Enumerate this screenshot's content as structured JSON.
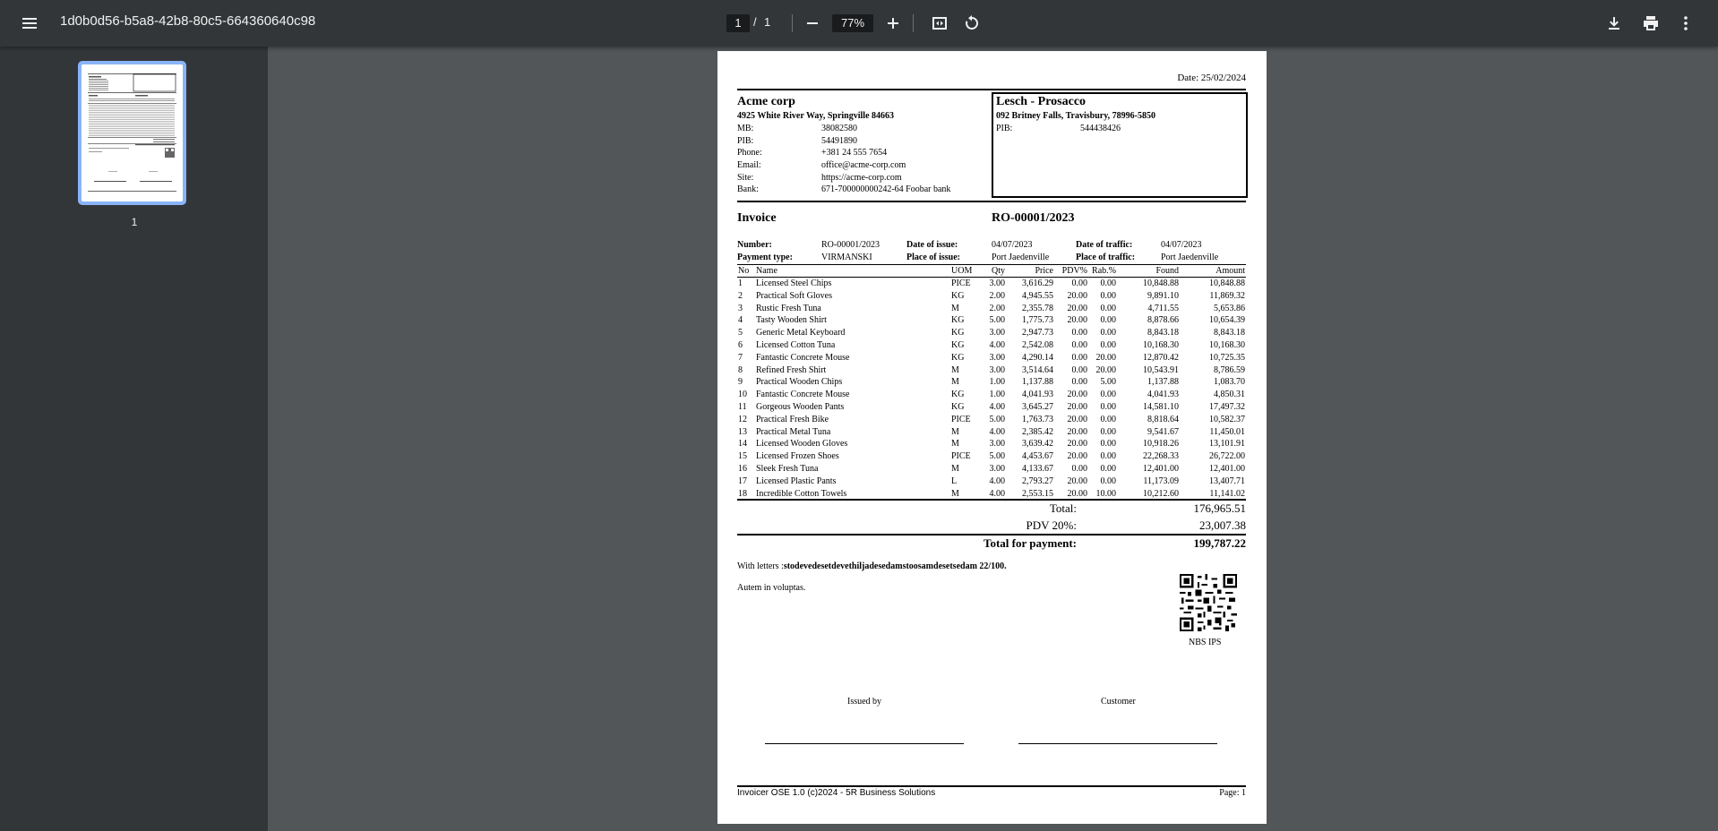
{
  "toolbar": {
    "doc_title": "1d0b0d56-b5a8-42b8-80c5-664360640c98",
    "current_page": "1",
    "page_separator": "/",
    "total_pages": "1",
    "zoom": "77%"
  },
  "sidebar": {
    "thumb_page_number": "1"
  },
  "invoice": {
    "date_line": "Date: 25/02/2024",
    "seller": {
      "name": "Acme corp",
      "address": "4925 White River Way, Springville 84663",
      "fields": [
        {
          "label": "MB:",
          "value": "38082580"
        },
        {
          "label": "PIB:",
          "value": "54491890"
        },
        {
          "label": "Phone:",
          "value": "+381 24 555 7654"
        },
        {
          "label": "Email:",
          "value": "office@acme-corp.com"
        },
        {
          "label": "Site:",
          "value": "https://acme-corp.com"
        },
        {
          "label": "Bank:",
          "value": "671-700000000242-64 Foobar bank"
        }
      ]
    },
    "buyer": {
      "name": "Lesch - Prosacco",
      "address": "092 Britney Falls, Travisbury, 78996-5850",
      "pib_label": "PIB:",
      "pib_value": "544438426"
    },
    "title": "Invoice",
    "number_title": "RO-00001/2023",
    "meta": {
      "number_label": "Number:",
      "number_value": "RO-00001/2023",
      "date_issue_label": "Date of issue:",
      "date_issue_value": "04/07/2023",
      "date_traffic_label": "Date of traffic:",
      "date_traffic_value": "04/07/2023",
      "payment_type_label": "Payment type:",
      "payment_type_value": "VIRMANSKI",
      "place_issue_label": "Place of issue:",
      "place_issue_value": "Port Jaedenville",
      "place_traffic_label": "Place of traffic:",
      "place_traffic_value": "Port Jaedenville"
    },
    "columns": [
      "No",
      "Name",
      "UOM",
      "Qty",
      "Price",
      "PDV%",
      "Rab.%",
      "Found",
      "Amount"
    ],
    "items": [
      [
        "1",
        "Licensed Steel Chips",
        "PICE",
        "3.00",
        "3,616.29",
        "0.00",
        "0.00",
        "10,848.88",
        "10,848.88"
      ],
      [
        "2",
        "Practical Soft Gloves",
        "KG",
        "2.00",
        "4,945.55",
        "20.00",
        "0.00",
        "9,891.10",
        "11,869.32"
      ],
      [
        "3",
        "Rustic Fresh Tuna",
        "M",
        "2.00",
        "2,355.78",
        "20.00",
        "0.00",
        "4,711.55",
        "5,653.86"
      ],
      [
        "4",
        "Tasty Wooden Shirt",
        "KG",
        "5.00",
        "1,775.73",
        "20.00",
        "0.00",
        "8,878.66",
        "10,654.39"
      ],
      [
        "5",
        "Generic Metal Keyboard",
        "KG",
        "3.00",
        "2,947.73",
        "0.00",
        "0.00",
        "8,843.18",
        "8,843.18"
      ],
      [
        "6",
        "Licensed Cotton Tuna",
        "KG",
        "4.00",
        "2,542.08",
        "0.00",
        "0.00",
        "10,168.30",
        "10,168.30"
      ],
      [
        "7",
        "Fantastic Concrete Mouse",
        "KG",
        "3.00",
        "4,290.14",
        "0.00",
        "20.00",
        "12,870.42",
        "10,725.35"
      ],
      [
        "8",
        "Refined Fresh Shirt",
        "M",
        "3.00",
        "3,514.64",
        "0.00",
        "20.00",
        "10,543.91",
        "8,786.59"
      ],
      [
        "9",
        "Practical Wooden Chips",
        "M",
        "1.00",
        "1,137.88",
        "0.00",
        "5.00",
        "1,137.88",
        "1,083.70"
      ],
      [
        "10",
        "Fantastic Concrete Mouse",
        "KG",
        "1.00",
        "4,041.93",
        "20.00",
        "0.00",
        "4,041.93",
        "4,850.31"
      ],
      [
        "11",
        "Gorgeous Wooden Pants",
        "KG",
        "4.00",
        "3,645.27",
        "20.00",
        "0.00",
        "14,581.10",
        "17,497.32"
      ],
      [
        "12",
        "Practical Fresh Bike",
        "PICE",
        "5.00",
        "1,763.73",
        "20.00",
        "0.00",
        "8,818.64",
        "10,582.37"
      ],
      [
        "13",
        "Practical Metal Tuna",
        "M",
        "4.00",
        "2,385.42",
        "20.00",
        "0.00",
        "9,541.67",
        "11,450.01"
      ],
      [
        "14",
        "Licensed Wooden Gloves",
        "M",
        "3.00",
        "3,639.42",
        "20.00",
        "0.00",
        "10,918.26",
        "13,101.91"
      ],
      [
        "15",
        "Licensed Frozen Shoes",
        "PICE",
        "5.00",
        "4,453.67",
        "20.00",
        "0.00",
        "22,268.33",
        "26,722.00"
      ],
      [
        "16",
        "Sleek Fresh Tuna",
        "M",
        "3.00",
        "4,133.67",
        "0.00",
        "0.00",
        "12,401.00",
        "12,401.00"
      ],
      [
        "17",
        "Licensed Plastic Pants",
        "L",
        "4.00",
        "2,793.27",
        "20.00",
        "0.00",
        "11,173.09",
        "13,407.71"
      ],
      [
        "18",
        "Incredible Cotton Towels",
        "M",
        "4.00",
        "2,553.15",
        "20.00",
        "10.00",
        "10,212.60",
        "11,141.02"
      ]
    ],
    "totals": {
      "total_label": "Total:",
      "total_value": "176,965.51",
      "pdv_label": "PDV 20%:",
      "pdv_value": "23,007.38",
      "payment_label": "Total for payment:",
      "payment_value": "199,787.22"
    },
    "with_letters_label": "With letters :",
    "with_letters_value": "stodevedesetdevethiljadesedamstoosamdesetsedam 22/100.",
    "note": "Autem in voluptas.",
    "qr_caption": "NBS IPS",
    "issued_by": "Issued by",
    "customer": "Customer",
    "footer_left": "Invoicer OSE 1.0 (c)2024 - 5R Business Solutions",
    "footer_right": "Page: 1"
  }
}
